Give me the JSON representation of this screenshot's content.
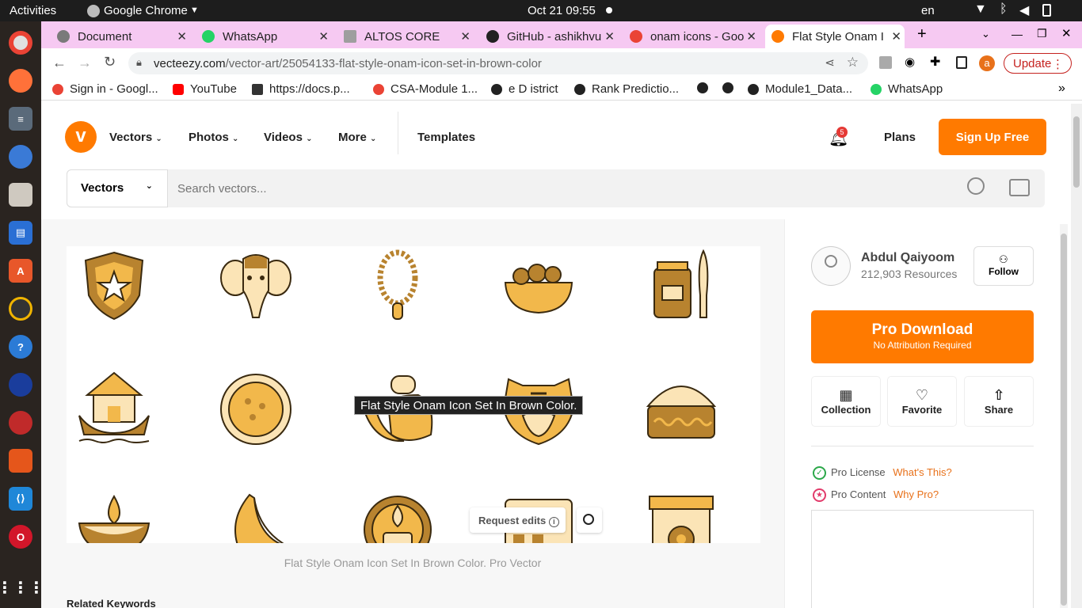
{
  "system": {
    "activities": "Activities",
    "app": "Google Chrome",
    "datetime": "Oct 21  09:55",
    "lang": "en"
  },
  "tabs": [
    {
      "label": "Document",
      "color": "#7a7a7a"
    },
    {
      "label": "WhatsApp",
      "color": "#25d366"
    },
    {
      "label": "ALTOS CORE",
      "color": "#9e9e9e"
    },
    {
      "label": "GitHub - ashikhvu",
      "color": "#222"
    },
    {
      "label": "onam icons - Goo",
      "color": "#ea4335"
    },
    {
      "label": "Flat Style Onam I",
      "color": "#ff7a00"
    }
  ],
  "url": {
    "domain": "vecteezy.com",
    "path": "/vector-art/25054133-flat-style-onam-icon-set-in-brown-color"
  },
  "update_label": "Update",
  "profile_initial": "a",
  "bookmarks": [
    {
      "label": "Sign in - Googl...",
      "color": "#ea4335"
    },
    {
      "label": "YouTube",
      "color": "#ff0000"
    },
    {
      "label": "https://docs.p...",
      "color": "#333"
    },
    {
      "label": "CSA-Module 1...",
      "color": "#ea4335"
    },
    {
      "label": "e D istrict",
      "color": "#222"
    },
    {
      "label": "Rank Predictio...",
      "color": "#222"
    },
    {
      "label": "",
      "color": "#222"
    },
    {
      "label": "",
      "color": "#222"
    },
    {
      "label": "Module1_Data...",
      "color": "#222"
    },
    {
      "label": "WhatsApp",
      "color": "#25d366"
    }
  ],
  "site": {
    "nav": [
      "Vectors",
      "Photos",
      "Videos",
      "More"
    ],
    "templates": "Templates",
    "notif_count": "5",
    "plans": "Plans",
    "signup": "Sign Up Free",
    "search_category": "Vectors",
    "search_placeholder": "Search vectors...",
    "tooltip": "Flat Style Onam Icon Set In Brown Color.",
    "request_edits": "Request edits",
    "caption": "Flat Style Onam Icon Set In Brown Color. Pro Vector",
    "related": "Related Keywords",
    "author": {
      "name": "Abdul Qaiyoom",
      "resources": "212,903 Resources",
      "follow": "Follow"
    },
    "pro_download": "Pro Download",
    "no_attr": "No Attribution Required",
    "actions": [
      "Collection",
      "Favorite",
      "Share"
    ],
    "license": {
      "label": "Pro License",
      "link": "What's This?"
    },
    "content": {
      "label": "Pro Content",
      "link": "Why Pro?"
    }
  },
  "colors": {
    "accent": "#ff7a00",
    "brown": "#b8832f",
    "tan": "#e9b65a",
    "cream": "#fbe4b6"
  }
}
